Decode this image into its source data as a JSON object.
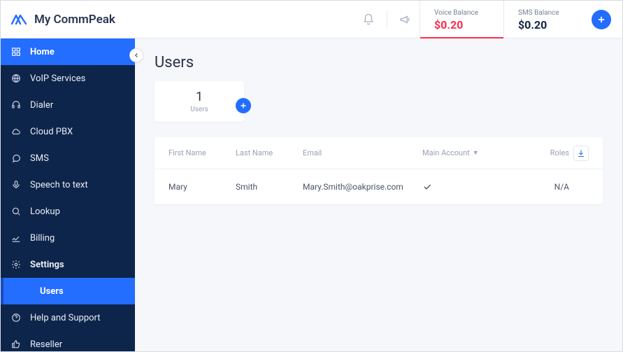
{
  "app": {
    "title": "My CommPeak"
  },
  "header": {
    "voice_balance_label": "Voice Balance",
    "voice_balance_value": "$0.20",
    "sms_balance_label": "SMS Balance",
    "sms_balance_value": "$0.20"
  },
  "sidebar": {
    "items": [
      {
        "label": "Home",
        "icon": "grid-icon"
      },
      {
        "label": "VoIP Services",
        "icon": "globe-icon"
      },
      {
        "label": "Dialer",
        "icon": "headset-icon"
      },
      {
        "label": "Cloud PBX",
        "icon": "cloud-icon"
      },
      {
        "label": "SMS",
        "icon": "chat-icon"
      },
      {
        "label": "Speech to text",
        "icon": "mic-icon"
      },
      {
        "label": "Lookup",
        "icon": "search-icon"
      },
      {
        "label": "Billing",
        "icon": "billing-icon"
      },
      {
        "label": "Settings",
        "icon": "gear-icon"
      },
      {
        "label": "Help and Support",
        "icon": "help-icon"
      },
      {
        "label": "Reseller",
        "icon": "thumbs-up-icon"
      }
    ],
    "sub_item_label": "Users"
  },
  "page": {
    "title": "Users",
    "count_value": "1",
    "count_label": "Users"
  },
  "table": {
    "columns": {
      "first_name": "First Name",
      "last_name": "Last Name",
      "email": "Email",
      "main_account": "Main Account",
      "roles": "Roles"
    },
    "rows": [
      {
        "first_name": "Mary",
        "last_name": "Smith",
        "email": "Mary.Smith@oakprise.com",
        "main_account": true,
        "roles": "N/A"
      }
    ]
  }
}
